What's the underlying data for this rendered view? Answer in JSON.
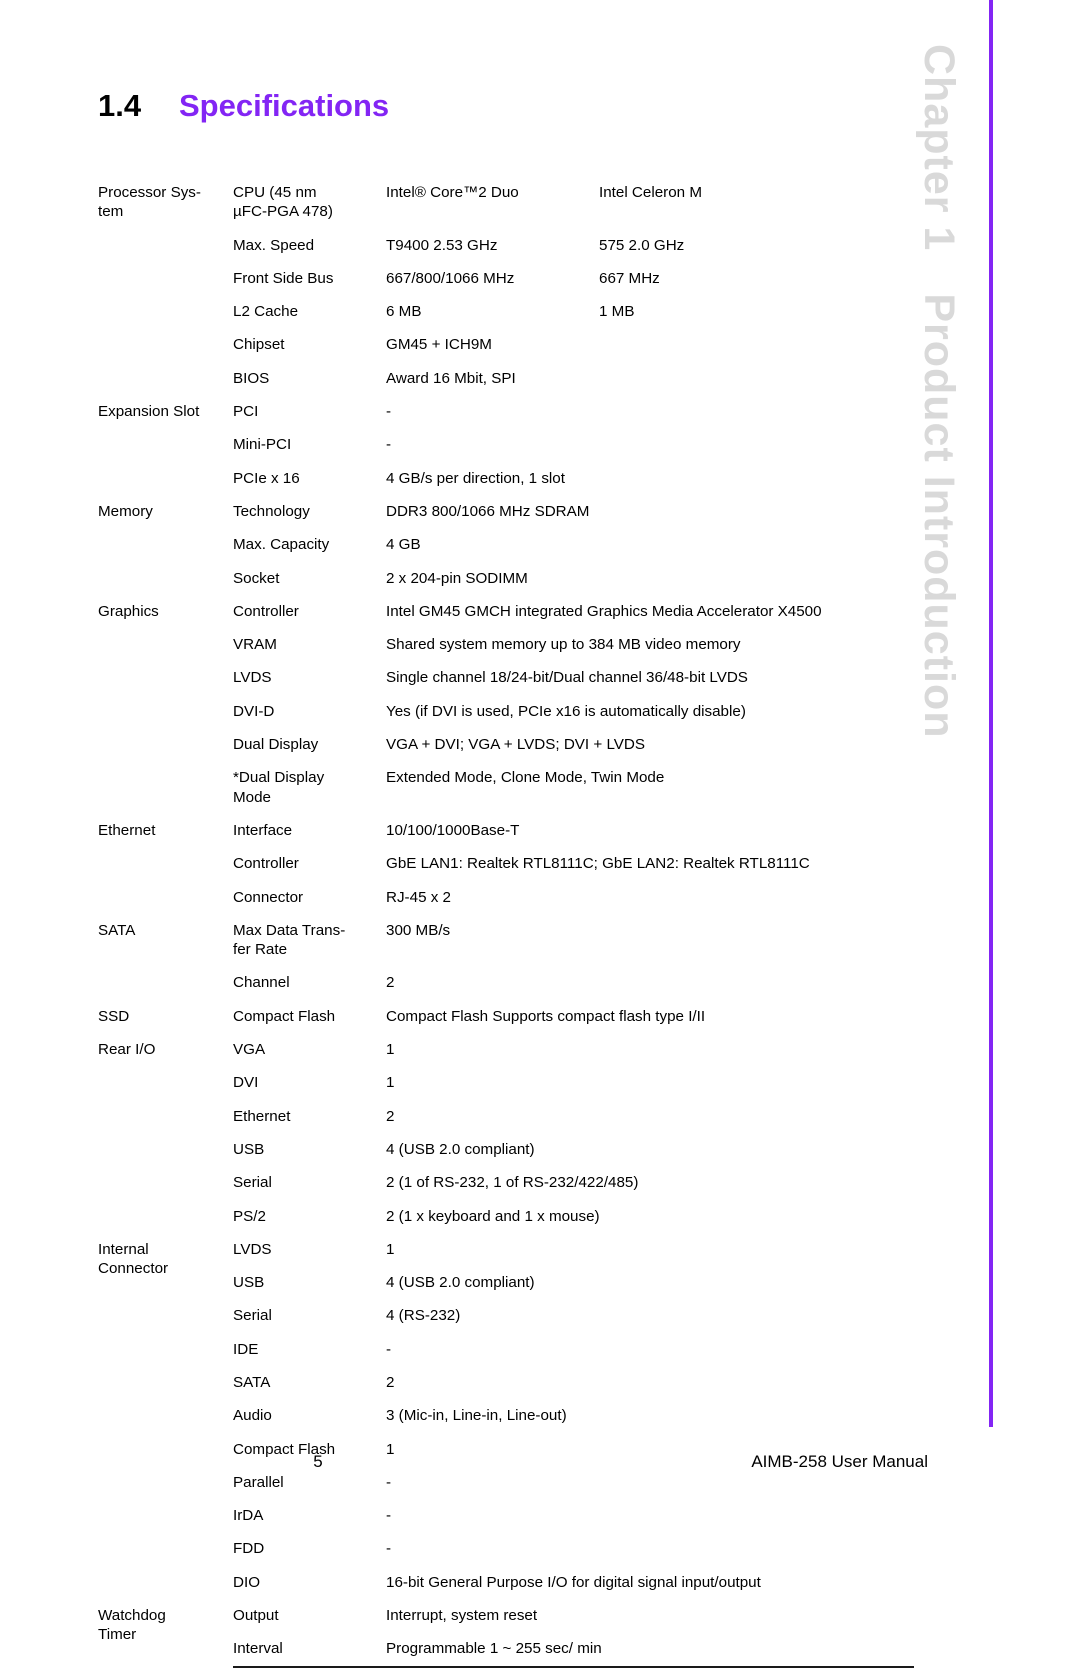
{
  "heading": {
    "number": "1.4",
    "title": "Specifications",
    "accent_color": "#8325f4"
  },
  "chapter_rail": {
    "chapter_label": "Chapter 1",
    "chapter_title": "Product Introduction",
    "rule_color": "#8325f4",
    "text_color": "#d9d9d9"
  },
  "footer": {
    "page_number": "5",
    "manual_title": "AIMB-258 User Manual"
  },
  "spec_table": {
    "groups": [
      {
        "name": "Processor Sys-\ntem",
        "rows": [
          {
            "item": "CPU (45 nm\nµFC-PGA 478)",
            "value1": "Intel® Core™2 Duo",
            "value2": "Intel Celeron M"
          },
          {
            "item": "Max. Speed",
            "value1": "T9400 2.53 GHz",
            "value2": "575 2.0 GHz"
          },
          {
            "item": "Front Side Bus",
            "value1": "667/800/1066 MHz",
            "value2": "667 MHz"
          },
          {
            "item": "L2 Cache",
            "value1": "6 MB",
            "value2": "1 MB"
          },
          {
            "item": "Chipset",
            "value": "GM45 + ICH9M"
          },
          {
            "item": "BIOS",
            "value": "Award 16 Mbit, SPI"
          }
        ]
      },
      {
        "name": "Expansion Slot",
        "rows": [
          {
            "item": "PCI",
            "value": "-"
          },
          {
            "item": "Mini-PCI",
            "value": "-"
          },
          {
            "item": "PCIe x 16",
            "value": "4 GB/s per direction, 1 slot"
          }
        ]
      },
      {
        "name": "Memory",
        "rows": [
          {
            "item": "Technology",
            "value": "DDR3 800/1066 MHz SDRAM"
          },
          {
            "item": "Max. Capacity",
            "value": "4 GB"
          },
          {
            "item": "Socket",
            "value": "2 x 204-pin SODIMM"
          }
        ]
      },
      {
        "name": "Graphics",
        "rows": [
          {
            "item": "Controller",
            "value": "Intel GM45 GMCH integrated Graphics Media Accelerator X4500"
          },
          {
            "item": "VRAM",
            "value": "Shared system memory up to 384 MB video memory"
          },
          {
            "item": "LVDS",
            "value": "Single channel 18/24-bit/Dual channel 36/48-bit LVDS"
          },
          {
            "item": "DVI-D",
            "value": "Yes (if DVI is used, PCIe x16 is automatically disable)"
          },
          {
            "item": "Dual Display",
            "value": "VGA + DVI; VGA + LVDS; DVI + LVDS"
          },
          {
            "item": "*Dual Display\nMode",
            "value": "Extended Mode, Clone Mode, Twin Mode"
          }
        ]
      },
      {
        "name": "Ethernet",
        "rows": [
          {
            "item": "Interface",
            "value": "10/100/1000Base-T"
          },
          {
            "item": "Controller",
            "value": "GbE LAN1: Realtek RTL8111C; GbE LAN2: Realtek RTL8111C"
          },
          {
            "item": "Connector",
            "value": "RJ-45 x 2"
          }
        ]
      },
      {
        "name": "SATA",
        "rows": [
          {
            "item": "Max Data Trans-\nfer Rate",
            "value": "300 MB/s"
          },
          {
            "item": "Channel",
            "value": "2"
          }
        ]
      },
      {
        "name": "SSD",
        "rows": [
          {
            "item": "Compact Flash",
            "value": "Compact Flash Supports compact flash type I/II"
          }
        ]
      },
      {
        "name": "Rear I/O",
        "rows": [
          {
            "item": "VGA",
            "value": "1"
          },
          {
            "item": "DVI",
            "value": "1"
          },
          {
            "item": "Ethernet",
            "value": "2"
          },
          {
            "item": "USB",
            "value": "4 (USB 2.0 compliant)"
          },
          {
            "item": "Serial",
            "value": "2 (1 of RS-232, 1 of RS-232/422/485)"
          },
          {
            "item": "PS/2",
            "value": "2 (1 x keyboard and 1 x mouse)"
          }
        ]
      },
      {
        "name": "Internal\nConnector",
        "rows": [
          {
            "item": "LVDS",
            "value": "1"
          },
          {
            "item": "USB",
            "value": "4 (USB 2.0 compliant)"
          },
          {
            "item": "Serial",
            "value": "4 (RS-232)"
          },
          {
            "item": "IDE",
            "value": "-"
          },
          {
            "item": "SATA",
            "value": "2"
          },
          {
            "item": "Audio",
            "value": "3 (Mic-in, Line-in, Line-out)"
          },
          {
            "item": "Compact Flash",
            "value": "1"
          },
          {
            "item": "Parallel",
            "value": "-"
          },
          {
            "item": "IrDA",
            "value": "-"
          },
          {
            "item": "FDD",
            "value": "-"
          },
          {
            "item": "DIO",
            "value": "16-bit General Purpose I/O for digital signal input/output"
          }
        ]
      },
      {
        "name": "Watchdog\nTimer",
        "rows": [
          {
            "item": "Output",
            "value": "Interrupt, system reset"
          },
          {
            "item": "Interval",
            "value": "Programmable 1 ~ 255 sec/ min"
          }
        ]
      }
    ]
  }
}
